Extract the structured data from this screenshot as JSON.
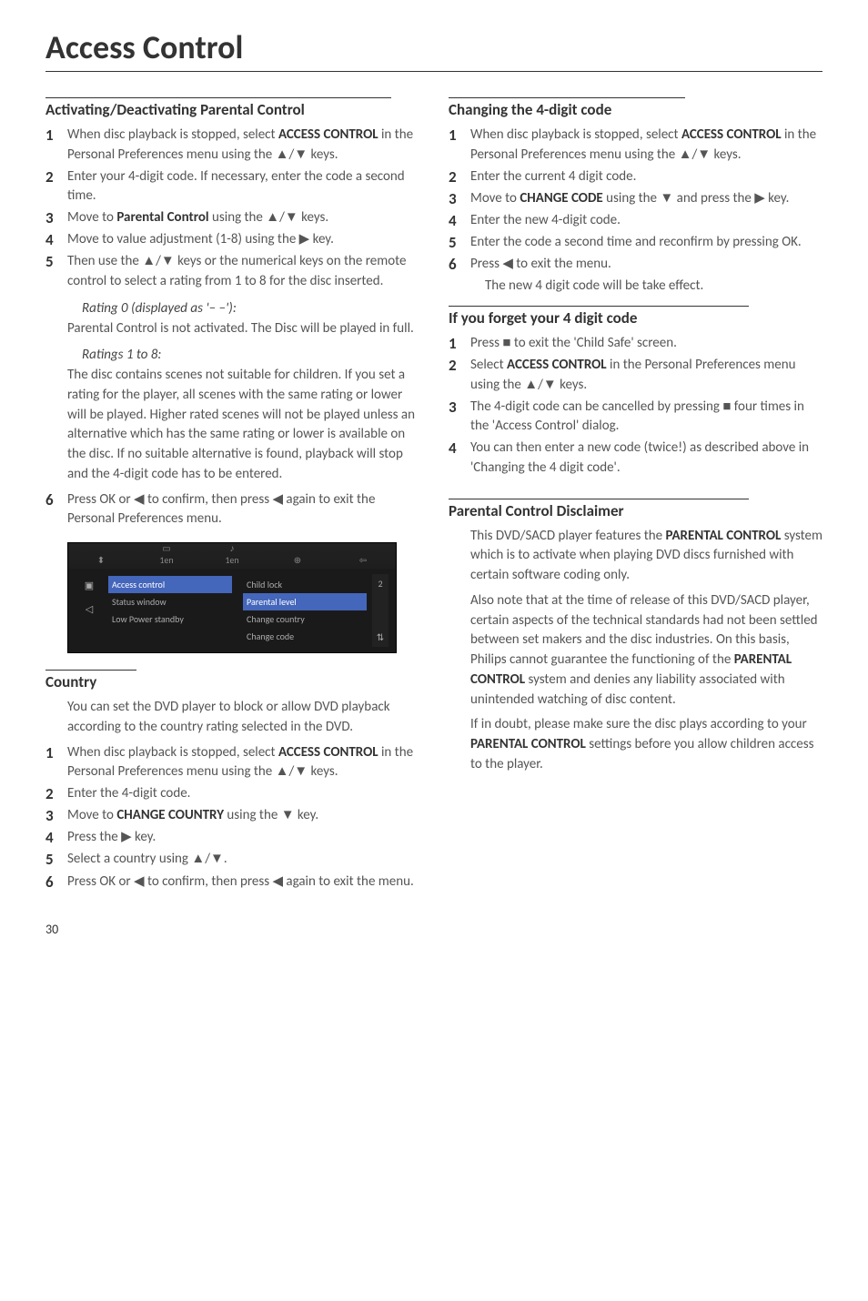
{
  "page_number": "30",
  "main_title": "Access Control",
  "sec1_heading": "Activating/Deactivating Parental Control",
  "sec1_step1": "When disc playback is stopped, select <b>ACCESS CONTROL</b> in the Personal Preferences menu using the ▲/▼ keys.",
  "sec1_step2": "Enter your 4-digit code. If necessary, enter the code a second time.",
  "sec1_step3": "Move to <b>Parental Control</b> using the ▲/▼ keys.",
  "sec1_step4": "Move to value adjustment (1-8) using the ▶ key.",
  "sec1_step5": "Then use the ▲/▼ keys or the numerical keys on the remote control to select a rating from 1 to 8 for the disc inserted.",
  "sec1_sub1_title": "Rating 0 (displayed as '– –'):",
  "sec1_sub1_body": "Parental Control is not activated. The Disc will be played in full.",
  "sec1_sub2_title": "Ratings 1 to 8:",
  "sec1_sub2_body": "The disc contains scenes not suitable for children. If you set a rating for the player, all scenes with the same rating or lower will be played. Higher rated scenes will not be played unless an alternative which has the same rating or lower is available on the disc. If no suitable alternative is found, playback will stop and the 4-digit code has to be entered.",
  "sec1_step6": "Press OK or ◀ to confirm, then press ◀ again to exit the Personal Preferences menu.",
  "shot_tab_1en_a": "1en",
  "shot_tab_1en_b": "1en",
  "shot_item_access": "Access control",
  "shot_item_status": "Status window",
  "shot_item_low": "Low Power standby",
  "shot_item_child": "Child lock",
  "shot_item_parental": "Parental level",
  "shot_item_country": "Change country",
  "shot_item_code": "Change code",
  "shot_side_num": "2",
  "shot_side_arrows": "⇅",
  "sec2_heading": "Country",
  "sec2_intro": "You can set the DVD player to block or allow DVD playback according to the country rating selected in the DVD.",
  "sec2_step1": "When disc playback is stopped, select <b>ACCESS CONTROL</b> in the Personal Preferences menu using the ▲/▼ keys.",
  "sec2_step2": "Enter the 4-digit code.",
  "sec2_step3": "Move to <b>CHANGE COUNTRY</b> using the ▼ key.",
  "sec2_step4": "Press the ▶ key.",
  "sec2_step5": "Select a country using ▲/▼.",
  "sec2_step6": "Press OK or ◀ to confirm, then press ◀ again to exit the menu.",
  "sec3_heading": "Changing the 4-digit code",
  "sec3_step1": "When disc playback is stopped, select <b>ACCESS CONTROL</b> in the Personal Preferences menu using the ▲/▼ keys.",
  "sec3_step2": "Enter the current 4 digit code.",
  "sec3_step3": "Move to <b>CHANGE CODE</b> using the ▼ and press the ▶ key.",
  "sec3_step4": "Enter the new 4-digit code.",
  "sec3_step5": "Enter the code a second time and reconfirm by pressing OK.",
  "sec3_step6": "Press ◀ to exit the menu.",
  "sec3_step6_result": "The new 4 digit code will be take effect.",
  "sec4_heading": "If you forget your 4 digit code",
  "sec4_step1": "Press ■ to exit the 'Child Safe' screen.",
  "sec4_step2": "Select <b>ACCESS CONTROL</b> in the Personal Preferences menu  using the ▲/▼ keys.",
  "sec4_step3": "The 4-digit code can be cancelled by pressing ■ four times in the 'Access Control' dialog.",
  "sec4_step4": "You can then enter a new code (twice!) as described above in 'Changing the 4 digit code'.",
  "sec5_heading": "Parental Control Disclaimer",
  "sec5_p1": "This DVD/SACD player features the <b>PARENTAL CONTROL</b> system which is to activate when playing DVD discs furnished with certain software coding only.",
  "sec5_p2": "Also note that at the time of release of this DVD/SACD player, certain aspects of the technical standards had not been settled between set makers and the disc industries. On this basis, Philips cannot guarantee the functioning of the <b>PARENTAL CONTROL</b> system and denies any liability associated with unintended watching of disc content.",
  "sec5_p3": "If in doubt, please make sure the disc plays according to your <b>PARENTAL CONTROL</b> settings before you allow children access to the player."
}
